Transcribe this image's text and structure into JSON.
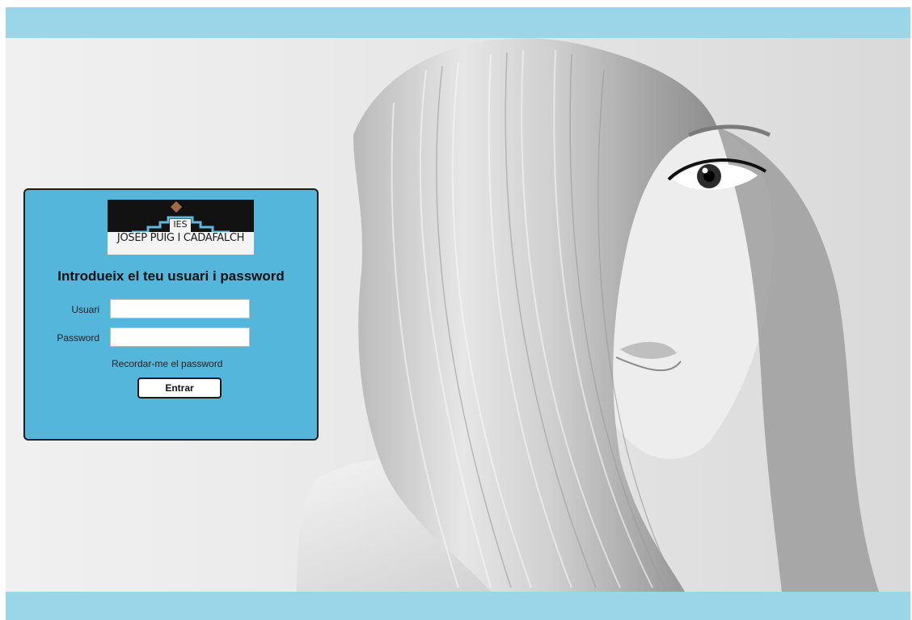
{
  "logo": {
    "ies": "IES",
    "name": "JOSEP PUIG I CADAFALCH"
  },
  "login": {
    "title": "Introdueix el teu usuari i password",
    "user_label": "Usuari",
    "user_value": "",
    "password_label": "Password",
    "password_value": "",
    "forgot_link": "Recordar-me el password",
    "submit_label": "Entrar"
  },
  "colors": {
    "bar": "#9ad6e8",
    "panel": "#55b6dc",
    "panel_border": "#1c1c1c"
  }
}
